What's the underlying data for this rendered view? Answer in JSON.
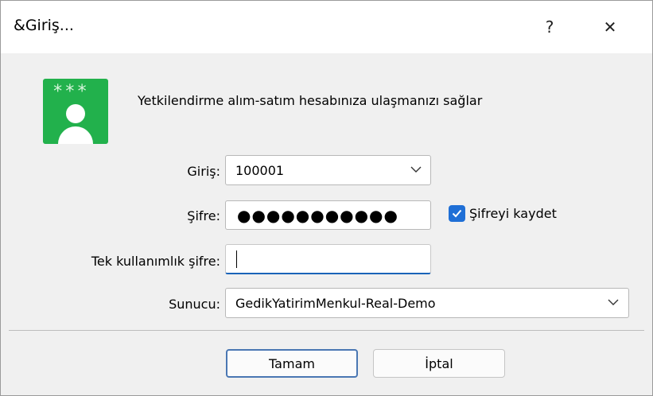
{
  "window": {
    "title": "&Giriş...",
    "help_glyph": "?",
    "close_glyph": "✕"
  },
  "header": {
    "description": "Yetkilendirme alım-satım hesabınıza ulaşmanızı sağlar",
    "icon": "user-credentials-icon",
    "icon_stars": "***",
    "icon_color": "#22b14c"
  },
  "form": {
    "login": {
      "label": "Giriş:",
      "value": "100001"
    },
    "password": {
      "label": "Şifre:",
      "masked_value": "●●●●●●●●●●●"
    },
    "save_password": {
      "label": "Şifreyi kaydet",
      "checked": true
    },
    "otp": {
      "label": "Tek kullanımlık şifre:",
      "value": ""
    },
    "server": {
      "label": "Sunucu:",
      "value": "GedikYatirimMenkul-Real-Demo"
    }
  },
  "buttons": {
    "ok": "Tamam",
    "cancel": "İptal"
  },
  "colors": {
    "accent": "#1f6fd6",
    "focus_underline": "#1a63b8",
    "dialog_bg": "#f0f0f0"
  }
}
